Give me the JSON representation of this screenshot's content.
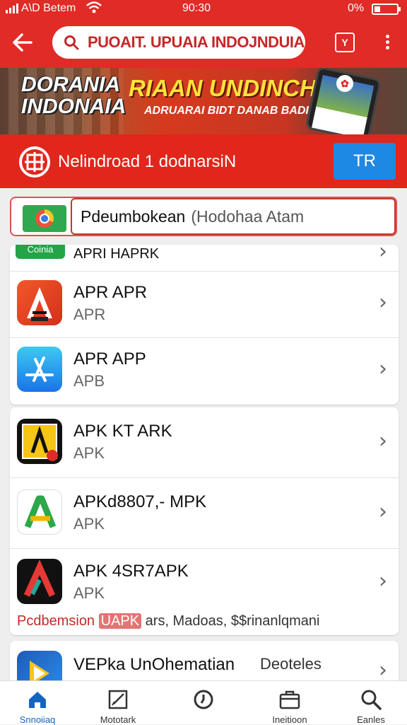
{
  "status_bar": {
    "carrier": "A\\D Betem",
    "time": "90:30",
    "battery": "0%"
  },
  "app_bar": {
    "search_text": "PUOAIT. UPUAIA INDOJNDUIA",
    "tab_icon_label": "Y"
  },
  "banner": {
    "left_title": "DORANIA INDONAIA",
    "main_title": "RIAAN UNDINCHAN",
    "sub_title": "ADRUARAI BIDT DANAB BADIU"
  },
  "section_header": {
    "title": "Nelindroad 1 dodnarsiN",
    "button": "TR"
  },
  "filter": {
    "field_strong": "Pdeumbokean",
    "field_rest": "(Hodohaa Atam"
  },
  "list_partial": {
    "badge": "Coinia",
    "name": "APRI HAPRK"
  },
  "list_group_1": [
    {
      "name": "APR APR",
      "sub": "APR",
      "icon": "adobe-style-icon"
    },
    {
      "name": "APR APP",
      "sub": "APB",
      "icon": "app-store-icon"
    }
  ],
  "list_group_2": [
    {
      "name": "APK KT ARK",
      "sub": "APK",
      "icon": "dark-app-icon"
    },
    {
      "name": "APKd8807,- MPK",
      "sub": "APK",
      "icon": "green-a-icon"
    },
    {
      "name": "APK 4SR7APK",
      "sub": "APK",
      "icon": "red-a-icon"
    }
  ],
  "promo": {
    "lead": "Pcdbemsion",
    "pill": "UAPK",
    "rest": "ars, Madoas, $$rinanlqmani"
  },
  "bottom_item": {
    "name": "VEPka UnOhematian",
    "meta": "Deoteles"
  },
  "bottom_nav": [
    {
      "label": "Snnoiiaq",
      "icon": "home-icon"
    },
    {
      "label": "Mototark",
      "icon": "edit-icon"
    },
    {
      "label": "",
      "icon": "clock-icon"
    },
    {
      "label": "Ineitioon",
      "icon": "briefcase-icon"
    },
    {
      "label": "Eanles",
      "icon": "search-icon"
    }
  ],
  "colors": {
    "primary_red": "#e02b27",
    "accent_blue": "#1e88e5",
    "nav_active": "#1565c0"
  }
}
